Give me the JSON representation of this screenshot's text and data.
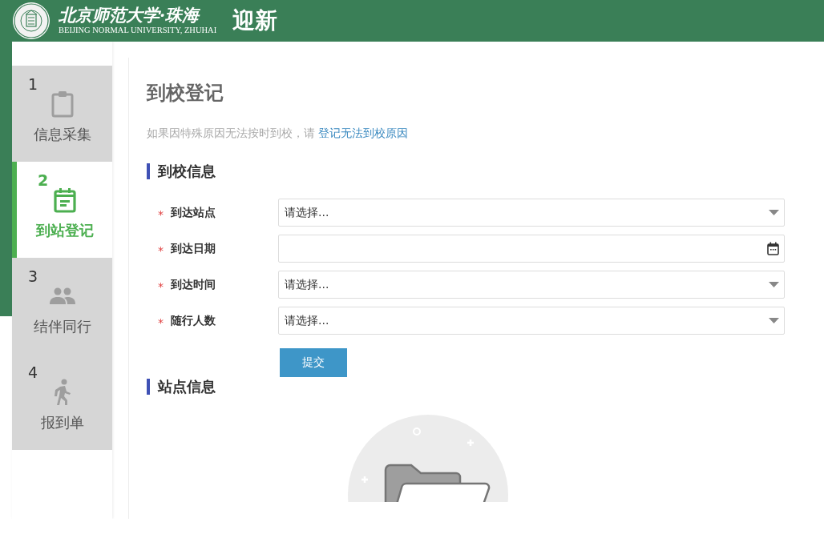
{
  "header": {
    "school_name": "北京师范大学·珠海",
    "school_name_en": "BEIJING NORMAL UNIVERSITY, ZHUHAI",
    "app_title": "迎新"
  },
  "steps": [
    {
      "number": "1",
      "label": "信息采集",
      "selected": false
    },
    {
      "number": "2",
      "label": "到站登记",
      "selected": true
    },
    {
      "number": "3",
      "label": "结伴同行",
      "selected": false
    },
    {
      "number": "4",
      "label": "报到单",
      "selected": false
    }
  ],
  "page_title": "到校登记",
  "notice": {
    "text": "如果因特殊原因无法按时到校，请",
    "link": "登记无法到校原因"
  },
  "sections": [
    {
      "title": "到校信息",
      "kind": "form",
      "fields": [
        {
          "label": "到达站点",
          "required_mark": "*",
          "kind": "select",
          "placeholder": "请选择..."
        },
        {
          "label": "到达日期",
          "required_mark": "*",
          "kind": "date"
        },
        {
          "label": "到达时间",
          "required_mark": "*",
          "kind": "select",
          "placeholder": "请选择..."
        },
        {
          "label": "随行人数",
          "required_mark": "*",
          "kind": "select",
          "placeholder": "请选择..."
        }
      ],
      "submit": "提交"
    },
    {
      "title": "站点信息",
      "kind": "empty"
    }
  ]
}
